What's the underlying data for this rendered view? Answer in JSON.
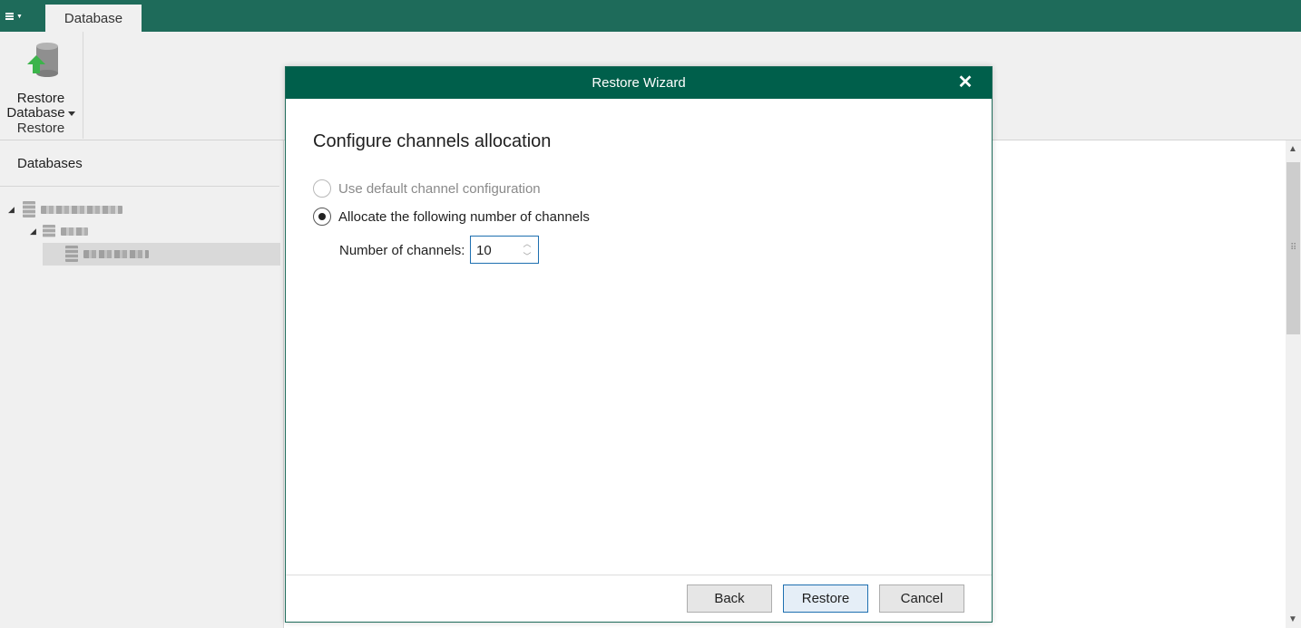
{
  "topbar": {
    "menu_icon": "hamburger-menu-icon",
    "tabs": [
      {
        "label": "Database"
      }
    ]
  },
  "ribbon": {
    "restore_database": {
      "line1": "Restore",
      "line2": "Database",
      "icon": "database-restore-icon"
    },
    "group_caption": "Restore"
  },
  "left_pane": {
    "title": "Databases",
    "tree_note": "tree node labels are pixelated/redacted in the screenshot"
  },
  "dialog": {
    "title": "Restore Wizard",
    "heading": "Configure channels allocation",
    "options": [
      {
        "label": "Use default channel configuration",
        "checked": false,
        "disabled": true
      },
      {
        "label": "Allocate the following number of channels",
        "checked": true,
        "disabled": false
      }
    ],
    "channels": {
      "label": "Number of channels:",
      "value": "10"
    },
    "buttons": {
      "back": "Back",
      "restore": "Restore",
      "cancel": "Cancel"
    }
  },
  "colors": {
    "topbar": "#1e6b5a",
    "dialog_title": "#005f4b",
    "focus_border": "#1e6fb0",
    "restore_arrow": "#3cb44b"
  }
}
